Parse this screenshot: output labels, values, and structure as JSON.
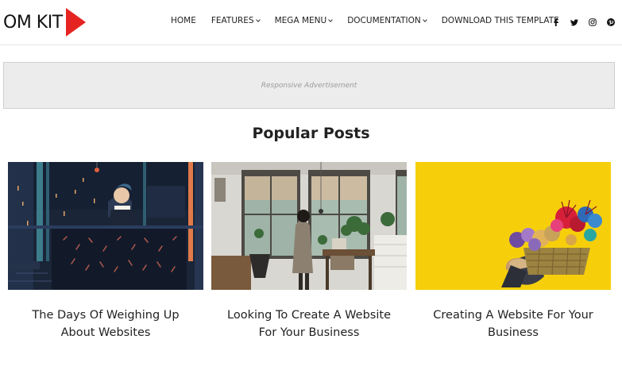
{
  "header": {
    "logo_text": "OM KIT",
    "nav": [
      {
        "label": "HOME",
        "dropdown": false
      },
      {
        "label": "FEATURES",
        "dropdown": true
      },
      {
        "label": "MEGA MENU",
        "dropdown": true
      },
      {
        "label": "DOCUMENTATION",
        "dropdown": true
      },
      {
        "label": "DOWNLOAD THIS TEMPLATE",
        "dropdown": false
      }
    ],
    "social": [
      "facebook-icon",
      "twitter-icon",
      "instagram-icon",
      "pinterest-icon"
    ]
  },
  "ad": {
    "text": "Responsive Advertisement"
  },
  "popular": {
    "title": "Popular Posts",
    "posts": [
      {
        "title": "The Days Of Weighing Up About Websites",
        "image": "illustrated-man-at-night-window"
      },
      {
        "title": "Looking To Create A Website For Your Business",
        "image": "woman-in-bright-room-with-plants"
      },
      {
        "title": "Creating A Website For Your Business",
        "image": "flower-basket-on-yellow-wall"
      }
    ]
  },
  "colors": {
    "brand_red": "#e52421",
    "ad_bg": "#ececec",
    "yellow_bg": "#f6cf0a"
  }
}
